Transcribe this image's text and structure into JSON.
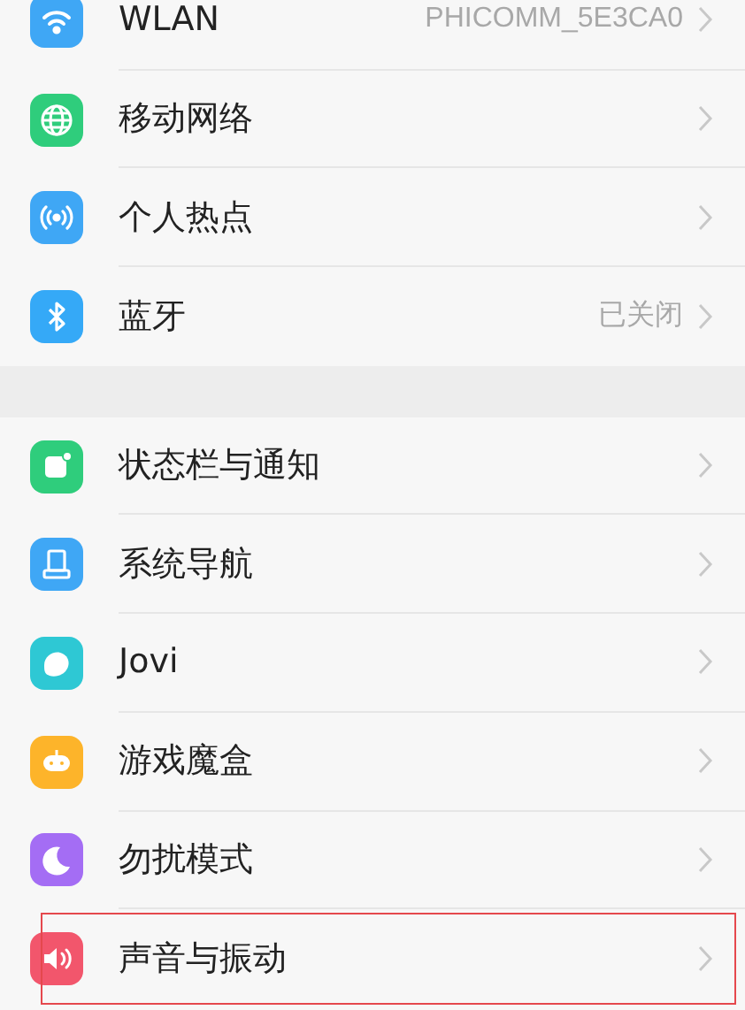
{
  "sections": [
    {
      "items": [
        {
          "label": "WLAN",
          "value": "PHICOMM_5E3CA0",
          "highlighted": false
        },
        {
          "label": "移动网络",
          "highlighted": false
        },
        {
          "label": "个人热点",
          "highlighted": false
        },
        {
          "label": "蓝牙",
          "value": "已关闭",
          "highlighted": false
        }
      ]
    },
    {
      "items": [
        {
          "label": "状态栏与通知",
          "highlighted": false
        },
        {
          "label": "系统导航",
          "highlighted": false
        },
        {
          "label": "Jovi",
          "highlighted": false
        },
        {
          "label": "游戏魔盒",
          "highlighted": false
        },
        {
          "label": "勿扰模式",
          "highlighted": false
        },
        {
          "label": "声音与振动",
          "highlighted": true
        }
      ]
    }
  ]
}
